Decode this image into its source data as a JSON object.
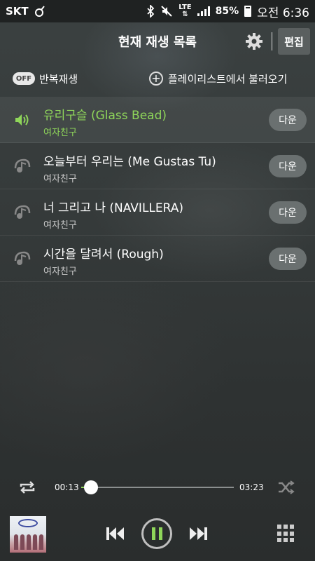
{
  "status_bar": {
    "carrier": "SKT",
    "network": "LTE",
    "battery": "85%",
    "time": "오전 6:36"
  },
  "header": {
    "title": "현재 재생 목록",
    "edit_label": "편집"
  },
  "options": {
    "repeat_toggle": "OFF",
    "repeat_label": "반복재생",
    "load_playlist_label": "플레이리스트에서 불러오기"
  },
  "tracks": [
    {
      "title": "유리구슬 (Glass Bead)",
      "artist": "여자친구",
      "button": "다운",
      "playing": true
    },
    {
      "title": "오늘부터 우리는 (Me Gustas Tu)",
      "artist": "여자친구",
      "button": "다운",
      "playing": false
    },
    {
      "title": "너 그리고 나 (NAVILLERA)",
      "artist": "여자친구",
      "button": "다운",
      "playing": false
    },
    {
      "title": "시간을 달려서 (Rough)",
      "artist": "여자친구",
      "button": "다운",
      "playing": false
    }
  ],
  "player": {
    "current_time": "00:13",
    "total_time": "03:23",
    "progress_fraction": 0.064
  },
  "colors": {
    "accent": "#8fd65a",
    "background": "#2f3434"
  },
  "icons": {
    "settings": "gear-icon",
    "add": "plus-circle-icon",
    "repeat": "repeat-icon",
    "shuffle": "shuffle-icon",
    "prev": "skip-previous-icon",
    "pause": "pause-icon",
    "next": "skip-next-icon",
    "menu": "grid-menu-icon"
  }
}
